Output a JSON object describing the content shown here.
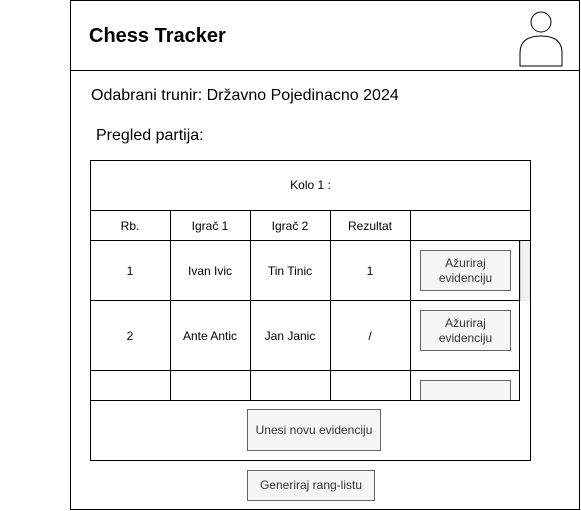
{
  "app": {
    "title": "Chess Tracker"
  },
  "tournament": {
    "label": "Odabrani trunir: Državno Pojedinacno 2024"
  },
  "overview": {
    "label": "Pregled partija:"
  },
  "table": {
    "round_title": "Kolo 1 :",
    "headers": [
      "Rb.",
      "Igrač 1",
      "Igrač 2",
      "Rezultat"
    ],
    "rows": [
      {
        "rb": "1",
        "player1": "Ivan Ivic",
        "player2": "Tin Tinic",
        "result": "1",
        "action": "Ažuriraj evidenciju"
      },
      {
        "rb": "2",
        "player1": "Ante Antic",
        "player2": "Jan Janic",
        "result": "/",
        "action": "Ažuriraj evidenciju"
      }
    ]
  },
  "buttons": {
    "new_entry": "Unesi novu evidenciju",
    "generate_ranking": "Generiraj rang-listu"
  },
  "icons": {
    "avatar": "user-avatar-icon"
  }
}
